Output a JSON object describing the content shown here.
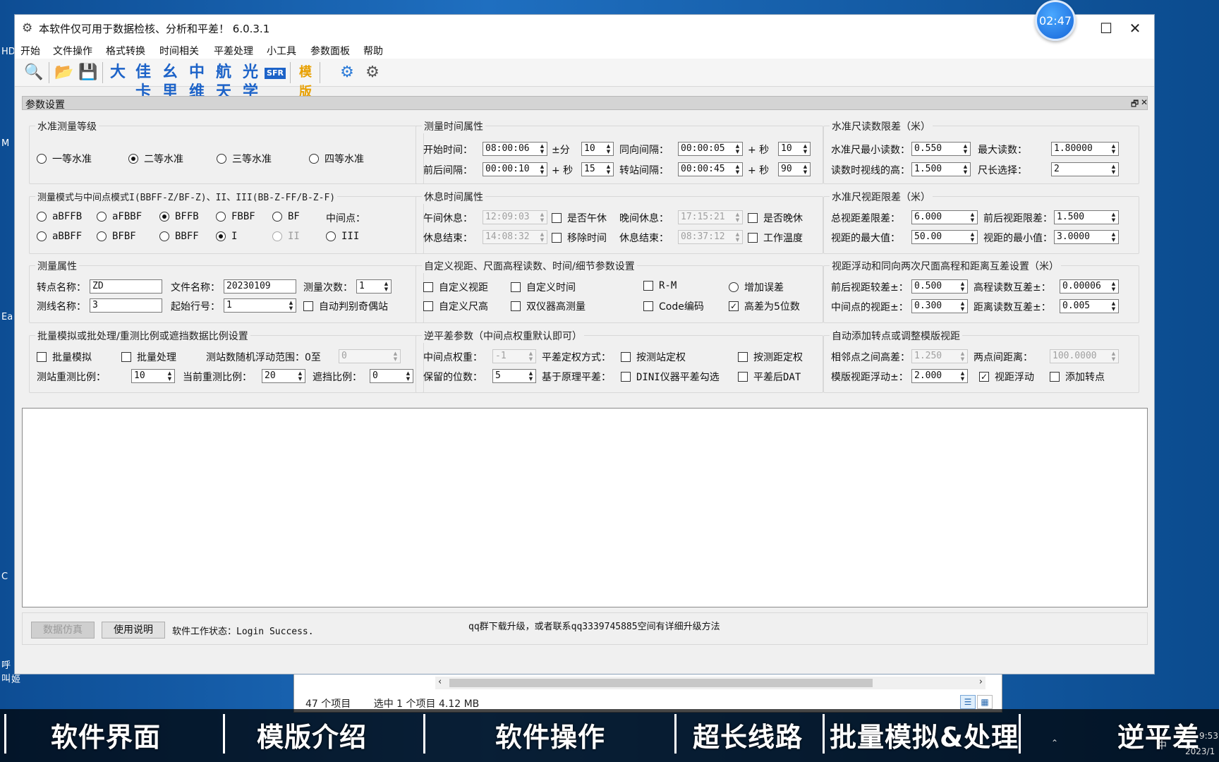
{
  "window": {
    "title": "本软件仅可用于数据检核、分析和平差！ 6.0.3.1",
    "clock": "02:47",
    "minimize": "—",
    "maximize": "☐",
    "close": "✕"
  },
  "menu": [
    "开始",
    "文件操作",
    "格式转换",
    "时间相关",
    "平差处理",
    "小工具",
    "参数面板",
    "帮助"
  ],
  "toolbar": {
    "text_icons": [
      "大",
      "佳卡",
      "幺里",
      "中维",
      "航天",
      "光学",
      "SFR"
    ],
    "template_icon": "模版"
  },
  "panel": {
    "title": "参数设置",
    "restore": "🗗",
    "close": "✕"
  },
  "level": {
    "title": "水准测量等级",
    "options": [
      "一等水准",
      "二等水准",
      "三等水准",
      "四等水准"
    ],
    "selected": 1
  },
  "mode": {
    "title": "测量模式与中间点模式I(BBFF-Z/BF-Z)、II、III(BB-Z-FF/B-Z-F)",
    "row1": [
      "aBFFB",
      "aFBBF",
      "BFFB",
      "FBBF",
      "BF"
    ],
    "row2": [
      "aBBFF",
      "BFBF",
      "BBFF"
    ],
    "mid_label": "中间点：",
    "mid_options": [
      "I",
      "II",
      "III"
    ]
  },
  "time": {
    "title": "测量时间属性",
    "start_label": "开始时间：",
    "start": "08:00:06",
    "pm_label": "±分",
    "pm": "10",
    "same_label": "同向间隔：",
    "same": "00:00:05",
    "plus_sec": "+ 秒",
    "same_sec": "10",
    "fb_label": "前后间隔：",
    "fb": "00:00:10",
    "fb_sec": "15",
    "turn_label": "转站间隔：",
    "turn": "00:00:45",
    "turn_sec": "90"
  },
  "rest": {
    "title": "休息时间属性",
    "noon_label": "午间休息：",
    "noon": "12:09:03",
    "noon_chk": "是否午休",
    "eve_label": "晚间休息：",
    "eve": "17:15:21",
    "eve_chk": "是否晚休",
    "end_label": "休息结束：",
    "end1": "14:08:32",
    "remove_chk": "移除时间",
    "end2": "08:37:12",
    "temp_chk": "工作温度"
  },
  "rod": {
    "title": "水准尺读数限差（米）",
    "min_label": "水准尺最小读数：",
    "min": "0.550",
    "max_label": "最大读数：",
    "max": "1.80000",
    "sight_label": "读数时视线的高：",
    "sight": "1.500",
    "len_label": "尺长选择：",
    "len": "2"
  },
  "dist": {
    "title": "水准尺视距限差（米）",
    "total_label": "总视距差限差：",
    "total": "6.000",
    "fb_label": "前后视距限差：",
    "fb": "1.500",
    "maxv_label": "视距的最大值：",
    "maxv": "50.00",
    "minv_label": "视距的最小值：",
    "minv": "3.0000"
  },
  "attr": {
    "title": "测量属性",
    "pt_label": "转点名称：",
    "pt": "ZD",
    "file_label": "文件名称：",
    "file": "20230109",
    "count_label": "测量次数：",
    "count": "1",
    "line_label": "测线名称：",
    "line": "3",
    "row_label": "起始行号：",
    "row": "1",
    "auto_chk": "自动判别奇偶站"
  },
  "custom": {
    "title": "自定义视距、尺面高程读数、时间/细节参数设置",
    "items": [
      "自定义视距",
      "自定义时间",
      "R-M",
      "自定义尺高",
      "双仪器高测量",
      "Code编码",
      "高差为5位数"
    ],
    "radio": "增加误差"
  },
  "float": {
    "title": "视距浮动和同向两次尺面高程和距离互差设置（米）",
    "fb_label": "前后视距较差±：",
    "fb": "0.500",
    "h_label": "高程读数互差±：",
    "h": "0.00006",
    "mid_label": "中间点的视距±：",
    "mid": "0.300",
    "d_label": "距离读数互差±：",
    "d": "0.005"
  },
  "batch": {
    "title": "批量模拟或批处理/重测比例或遮挡数据比例设置",
    "sim_chk": "批量模拟",
    "proc_chk": "批量处理",
    "range_label": "测站数随机浮动范围：0至",
    "range": "0",
    "re_label": "测站重测比例：",
    "re": "10",
    "cur_label": "当前重测比例：",
    "cur": "20",
    "occ_label": "遮挡比例：",
    "occ": "0"
  },
  "inverse": {
    "title": "逆平差参数（中间点权重默认即可）",
    "w_label": "中间点权重：",
    "w": "-1",
    "mode_label": "平差定权方式：",
    "by_station": "按测站定权",
    "by_dist": "按测距定权",
    "dig_label": "保留的位数：",
    "dig": "5",
    "base_label": "基于原理平差：",
    "dini_chk": "DINI仪器平差勾选",
    "dat_chk": "平差后DAT"
  },
  "auto": {
    "title": "自动添加转点或调整模版视距",
    "hd_label": "相邻点之间高差：",
    "hd": "1.250",
    "pd_label": "两点间距离：",
    "pd": "100.0000",
    "tf_label": "模版视距浮动±：",
    "tf": "2.000",
    "float_chk": "视距浮动",
    "add_chk": "添加转点"
  },
  "bottom": {
    "sim_btn": "数据仿真",
    "help_btn": "使用说明",
    "status": "软件工作状态：Login Success.",
    "notice": "qq群下载升级，或者联系qq3339745885空间有详细升级方法"
  },
  "explorer": {
    "count": "47 个项目",
    "selected": "选中 1 个项目  4.12 MB"
  },
  "captions": [
    "软件界面",
    "模版介绍",
    "软件操作",
    "超长线路",
    "批量模拟&处理",
    "逆平差"
  ],
  "tray": {
    "lang": "中",
    "time": "9:53",
    "date": "2023/1"
  },
  "desktop_side": [
    "HD",
    "M",
    "Ea",
    "C",
    "呼叫",
    "姬"
  ],
  "colors": {
    "accent": "#1d63c8",
    "window_bg": "#f0f0f0"
  }
}
